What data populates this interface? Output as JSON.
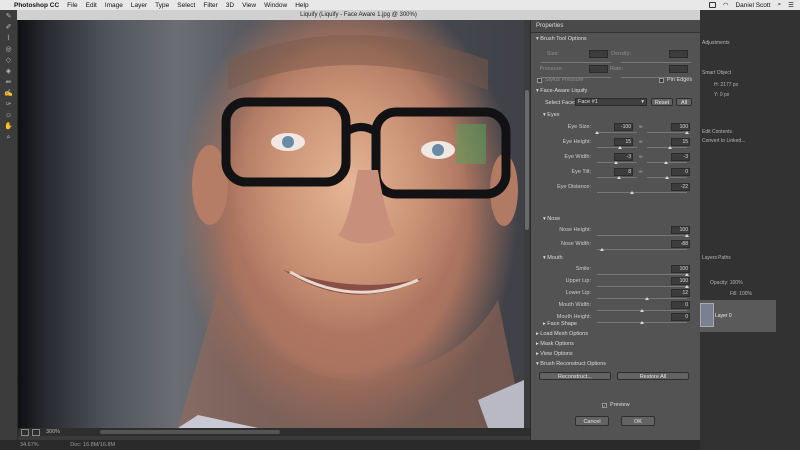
{
  "menubar": {
    "app": "Photoshop CC",
    "items": [
      "File",
      "Edit",
      "Image",
      "Layer",
      "Type",
      "Select",
      "Filter",
      "3D",
      "View",
      "Window",
      "Help"
    ],
    "user": "Daniel Scott"
  },
  "window_title": "Liquify (Liquify - Face Aware 1.jpg @ 300%)",
  "canvas_footer": {
    "zoom": "300%"
  },
  "status_bar": {
    "zoom": "34.67%",
    "doc": "Doc: 16.8M/16.8M"
  },
  "properties": {
    "title": "Properties",
    "brush_tool_options": {
      "header": "Brush Tool Options",
      "size": "Size:",
      "density": "Density:",
      "pressure": "Pressure:",
      "rate": "Rate:",
      "stylus_pressure": "Stylus Pressure",
      "pin_edges": "Pin Edges"
    },
    "face_aware": {
      "header": "Face-Aware Liquify",
      "select_face_label": "Select Face:",
      "select_face_value": "Face #1",
      "reset": "Reset",
      "all": "All",
      "eyes": {
        "header": "Eyes",
        "rows": [
          {
            "label": "Eye Size:",
            "left": "-100",
            "right": "100",
            "left_pos": 0.0,
            "right_pos": 1.0
          },
          {
            "label": "Eye Height:",
            "left": "15",
            "right": "15",
            "left_pos": 0.575,
            "right_pos": 0.575
          },
          {
            "label": "Eye Width:",
            "left": "-3",
            "right": "-3",
            "left_pos": 0.485,
            "right_pos": 0.485
          },
          {
            "label": "Eye Tilt:",
            "left": "8",
            "right": "0",
            "left_pos": 0.54,
            "right_pos": 0.5
          }
        ],
        "distance": {
          "label": "Eye Distance:",
          "value": "-22",
          "pos": 0.39
        }
      },
      "nose": {
        "header": "Nose",
        "rows": [
          {
            "label": "Nose Height:",
            "value": "100",
            "pos": 1.0
          },
          {
            "label": "Nose Width:",
            "value": "-88",
            "pos": 0.06
          }
        ]
      },
      "mouth": {
        "header": "Mouth",
        "rows": [
          {
            "label": "Smile:",
            "value": "100",
            "pos": 1.0
          },
          {
            "label": "Upper Lip:",
            "value": "100",
            "pos": 1.0
          },
          {
            "label": "Lower Lip:",
            "value": "12",
            "pos": 0.56
          },
          {
            "label": "Mouth Width:",
            "value": "0",
            "pos": 0.5
          },
          {
            "label": "Mouth Height:",
            "value": "0",
            "pos": 0.5
          }
        ]
      },
      "face_shape": "Face Shape"
    },
    "collapsed_sections": [
      "Load Mesh Options",
      "Mask Options",
      "View Options"
    ],
    "brush_reconstruct": {
      "header": "Brush Reconstruct Options",
      "reconstruct": "Reconstruct...",
      "restore_all": "Restore All"
    },
    "preview": "Preview",
    "cancel": "Cancel",
    "ok": "OK"
  },
  "right_panels": {
    "adjustments": "Adjustments",
    "smart_object": "Smart Object",
    "h_val": "H: 2177 px",
    "y_val": "Y: 0 px",
    "edit_contents": "Edit Contents",
    "convert": "Convert to Linked...",
    "tabs": [
      "Layers",
      "Paths"
    ],
    "opacity": "Opacity: 100%",
    "fill": "Fill: 100%",
    "layer_name": "Layer 0"
  }
}
